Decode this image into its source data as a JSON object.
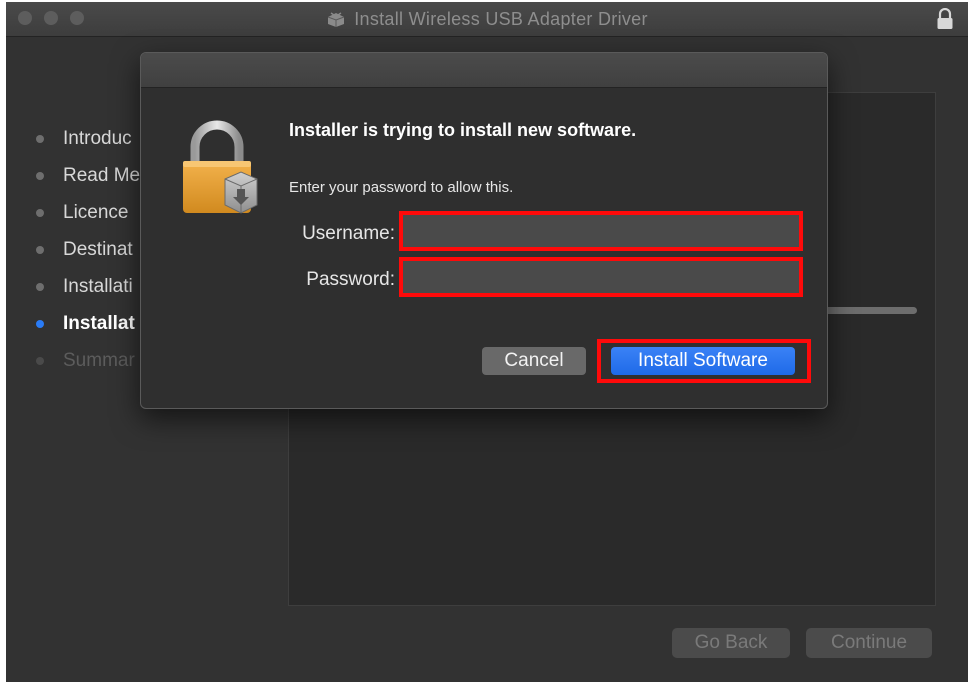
{
  "window": {
    "title": "Install Wireless USB Adapter Driver",
    "title_icon": "installer-box-icon",
    "lock_icon": "lock-icon"
  },
  "sidebar": {
    "items": [
      {
        "label": "Introduc",
        "state": "done"
      },
      {
        "label": "Read Me",
        "state": "done"
      },
      {
        "label": "Licence",
        "state": "done"
      },
      {
        "label": "Destinat",
        "state": "done"
      },
      {
        "label": "Installati",
        "state": "done"
      },
      {
        "label": "Installat",
        "state": "active"
      },
      {
        "label": "Summar",
        "state": "pending"
      }
    ]
  },
  "footer": {
    "go_back_label": "Go Back",
    "continue_label": "Continue"
  },
  "dialog": {
    "heading": "Installer is trying to install new software.",
    "subtext": "Enter your password to allow this.",
    "username_label": "Username:",
    "username_value": "",
    "password_label": "Password:",
    "password_value": "",
    "cancel_label": "Cancel",
    "install_label": "Install Software",
    "icon": "padlock-installer-icon"
  },
  "colors": {
    "accent": "#2a7cf7",
    "highlight": "#ff0a0a",
    "window_bg": "#323232"
  }
}
